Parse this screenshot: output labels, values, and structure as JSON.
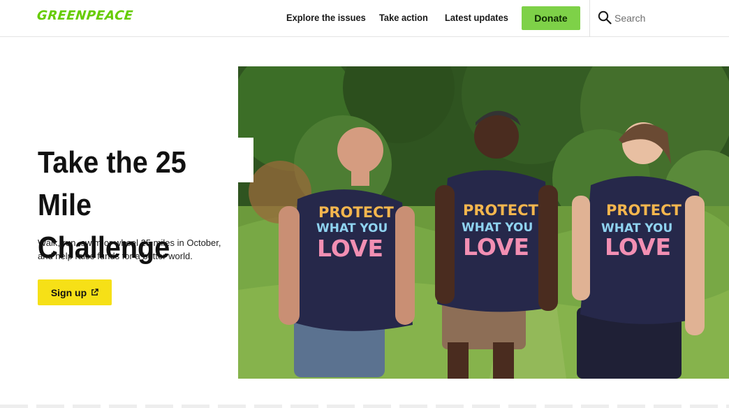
{
  "header": {
    "logo": "GREENPEACE",
    "nav": [
      "Explore the issues",
      "Take action",
      "Latest updates"
    ],
    "donate_label": "Donate",
    "search_placeholder": "Search"
  },
  "hero": {
    "title_line1": "Take the 25 Mile",
    "title_line2": "Challenge",
    "description": "Walk, run, swim or wheel 25 miles in October, and help raise funds for a better world.",
    "cta_label": "Sign up",
    "cta_icon": "external-link-icon"
  },
  "image": {
    "shirt_line1": "PROTECT",
    "shirt_line2": "WHAT YOU",
    "shirt_line3": "LOVE"
  },
  "colors": {
    "brand_green": "#66cc00",
    "donate_bg": "#7ed148",
    "cta_bg": "#f6e017",
    "shirt_navy": "#26284a"
  }
}
